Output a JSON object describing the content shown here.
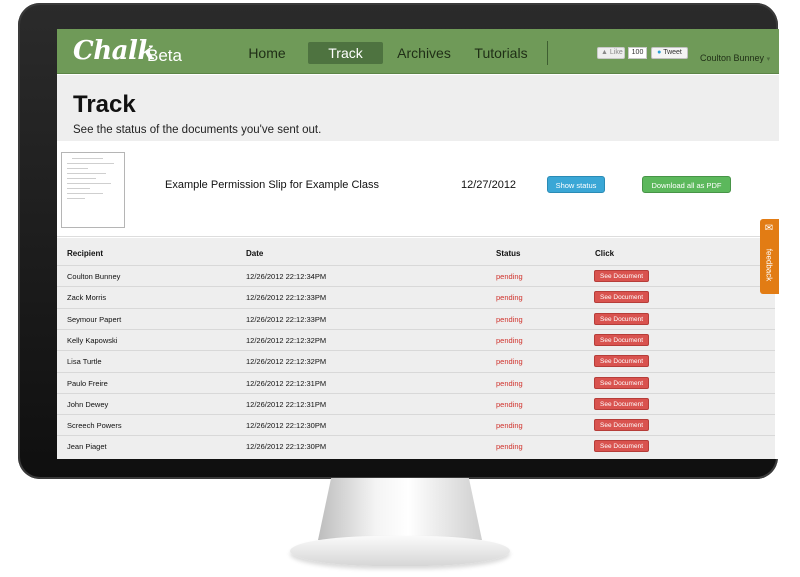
{
  "header": {
    "brand": "Chalk",
    "brand_sub": "Beta",
    "nav": [
      "Home",
      "Track",
      "Archives",
      "Tutorials"
    ],
    "active_nav": "Track",
    "like_label": "Like",
    "like_count": "100",
    "tweet_label": "Tweet",
    "user_name": "Coulton Bunney"
  },
  "page": {
    "title": "Track",
    "subtitle": "See the status of the documents you've sent out."
  },
  "document": {
    "name": "Example Permission Slip for Example Class",
    "date": "12/27/2012",
    "show_status_label": "Show status",
    "download_label": "Download all as PDF"
  },
  "table": {
    "headers": [
      "Recipient",
      "Date",
      "Status",
      "Click"
    ],
    "action_label": "See Document",
    "rows": [
      {
        "recipient": "Coulton Bunney",
        "date": "12/26/2012 22:12:34PM",
        "status": "pending"
      },
      {
        "recipient": "Zack Morris",
        "date": "12/26/2012 22:12:33PM",
        "status": "pending"
      },
      {
        "recipient": "Seymour Papert",
        "date": "12/26/2012 22:12:33PM",
        "status": "pending"
      },
      {
        "recipient": "Kelly Kapowski",
        "date": "12/26/2012 22:12:32PM",
        "status": "pending"
      },
      {
        "recipient": "Lisa Turtle",
        "date": "12/26/2012 22:12:32PM",
        "status": "pending"
      },
      {
        "recipient": "Paulo Freire",
        "date": "12/26/2012 22:12:31PM",
        "status": "pending"
      },
      {
        "recipient": "John Dewey",
        "date": "12/26/2012 22:12:31PM",
        "status": "pending"
      },
      {
        "recipient": "Screech Powers",
        "date": "12/26/2012 22:12:30PM",
        "status": "pending"
      },
      {
        "recipient": "Jean Piaget",
        "date": "12/26/2012 22:12:30PM",
        "status": "pending"
      }
    ]
  },
  "feedback": {
    "label": "feedback",
    "icon": "megaphone-icon"
  },
  "colors": {
    "header_green": "#6f9a58",
    "active_nav": "#4e7340",
    "status_button": "#3aa7d6",
    "pdf_button": "#5cb85c",
    "see_document_button": "#d9534f",
    "pending_text": "#d0322c",
    "feedback_tab": "#e27c14"
  }
}
